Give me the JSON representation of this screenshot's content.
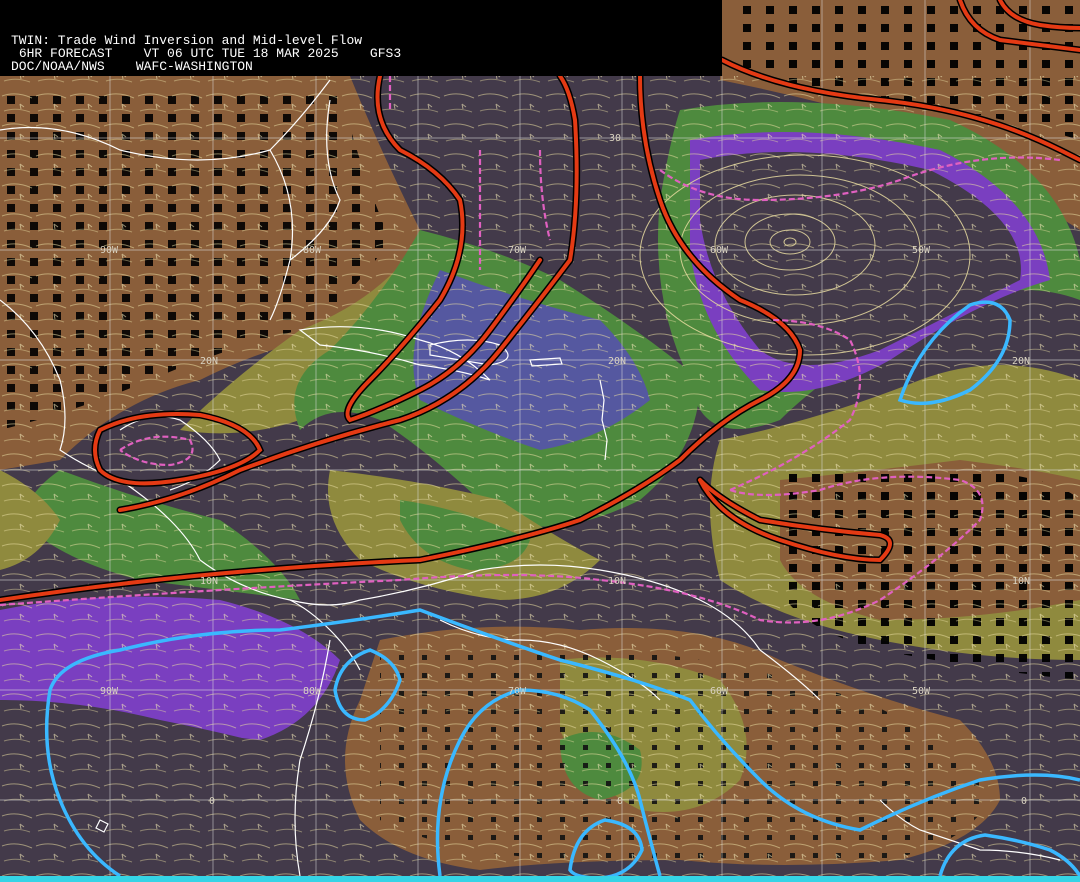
{
  "header": {
    "title": "TWIN: Trade Wind Inversion and Mid-level Flow",
    "forecast": "6HR FORECAST",
    "valid_time": "VT 06 UTC TUE 18 MAR 2025",
    "model": "GFS3",
    "agency": "DOC/NOAA/NWS",
    "center": "WAFC-WASHINGTON"
  },
  "grid_labels": {
    "lon_top": [
      "90W",
      "80W",
      "70W",
      "60W",
      "50W"
    ],
    "lon_bottom": [
      "90W",
      "80W",
      "70W",
      "60W",
      "50W"
    ],
    "lat_30": "30",
    "lat_20": [
      "20N",
      "20N",
      "20N"
    ],
    "lat_10": [
      "10N",
      "10N",
      "10N"
    ],
    "lat_0": [
      "0",
      "0",
      "0"
    ]
  },
  "colors": {
    "dark_base": "#433a4a",
    "purple": "#7a3fc0",
    "blue_band": "#5558a0",
    "green": "#4e8a3e",
    "olive": "#8f8a3e",
    "brown": "#8a5e3a",
    "red_contour": "#e43a14",
    "magenta_contour": "#e060c0",
    "cyan_contour": "#3ab8ff",
    "coastline": "#ffffff",
    "streamline": "#e8dca0"
  }
}
